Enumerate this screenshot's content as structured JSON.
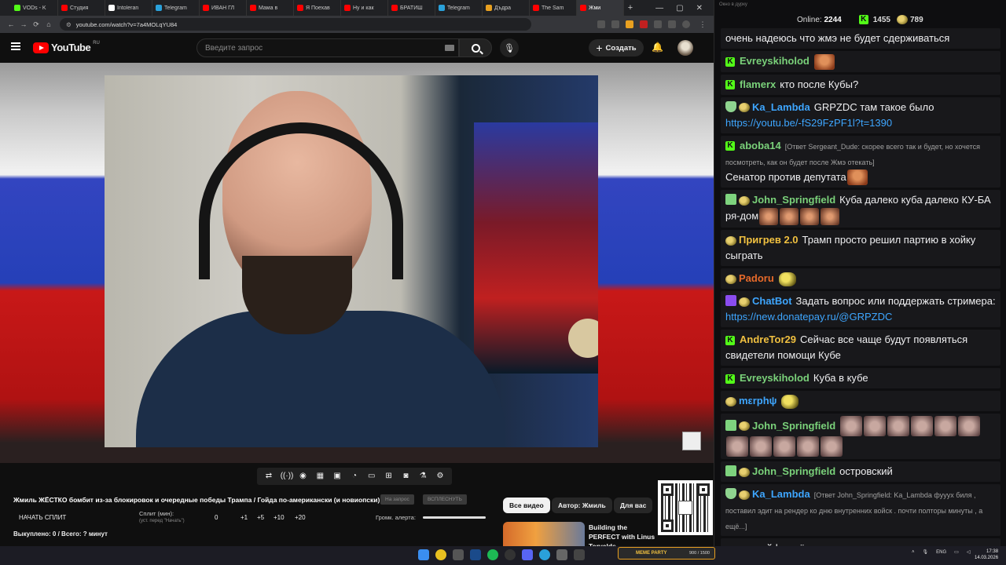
{
  "browser": {
    "tabs": [
      {
        "label": "VODs - K",
        "color": "#53fc18"
      },
      {
        "label": "Студия",
        "color": "#ff0000"
      },
      {
        "label": "Intoleran",
        "color": "#ffffff"
      },
      {
        "label": "Telegram",
        "color": "#2aa1da"
      },
      {
        "label": "ИВАН ГЛ",
        "color": "#ff0000"
      },
      {
        "label": "Мама в",
        "color": "#ff0000"
      },
      {
        "label": "Я Поехав",
        "color": "#ff0000"
      },
      {
        "label": "Ну и как",
        "color": "#ff0000"
      },
      {
        "label": "БРАТИШ",
        "color": "#ff0000"
      },
      {
        "label": "Telegram",
        "color": "#2aa1da"
      },
      {
        "label": "Дъдра",
        "color": "#e8a020"
      },
      {
        "label": "The Sam",
        "color": "#ff0000"
      },
      {
        "label": "Жми",
        "color": "#ff0000",
        "active": true
      }
    ],
    "new_tab": "+",
    "url": "youtube.com/watch?v=7a4MOLqYU84"
  },
  "youtube": {
    "logo_text": "YouTube",
    "logo_region": "RU",
    "search_placeholder": "Введите запрос",
    "create_label": "Создать",
    "video_title": "Жмиль ЖЁСТКО бомбит из-за блокировок и очередные победы Трампа / Гойда по-американски (и новиопски)",
    "title_btn_1": "На запрос",
    "title_btn_2": "ВСПЛЕСНУТЬ",
    "filters": [
      "Все видео",
      "Автор: Жмиль",
      "Для вас"
    ],
    "recommended_title": "Building the PERFECT with Linus Torvalds"
  },
  "split_panel": {
    "start_label": "НАЧАТЬ СПЛИТ",
    "split_label": "Сплит (мин):",
    "split_hint": "(уст. перед \"Начать\")",
    "values": [
      "0",
      "+1",
      "+5",
      "+10",
      "+20"
    ],
    "alert_label": "Громк. алерта:",
    "alert_level": 1.0,
    "paid_status": "Выкуплено: 0 / Всего: ? минут"
  },
  "chat": {
    "window_title": "Окно в дурку",
    "online_label": "Online:",
    "online_count": "2244",
    "kick_count": "1455",
    "pepe_count": "789",
    "messages": [
      {
        "user": "",
        "color": "#efeff1",
        "badges": [],
        "text": "очень надеюсь что жмэ не будет сдерживаться",
        "emotes": []
      },
      {
        "user": "Evreyskiholod",
        "color": "#7ad17a",
        "badges": [
          "kick"
        ],
        "text": "",
        "emotes": [
          "face"
        ]
      },
      {
        "user": "flamerx",
        "color": "#7ad17a",
        "badges": [
          "kick"
        ],
        "text": "кто после Кубы?",
        "emotes": []
      },
      {
        "user": "Ka_Lambda",
        "color": "#3ea6ff",
        "badges": [
          "shield",
          "pepe"
        ],
        "text": "GRPZDC там такое было",
        "link": "https://youtu.be/-fS29FzPF1l?t=1390",
        "emotes": []
      },
      {
        "user": "aboba14",
        "color": "#7ad17a",
        "badges": [
          "kick"
        ],
        "reply": "[Ответ Sergeant_Dude: скорее всего так и будет, но хочется посмотреть, как он будет после Жмэ отекать]",
        "text": "Сенатор против депутата",
        "emotes": [
          "face"
        ]
      },
      {
        "user": "John_Springfield",
        "color": "#7ad17a",
        "badges": [
          "pencil",
          "pepe"
        ],
        "text": "Куба далеко куба далеко КУ-БА ря-дом",
        "emotes": [
          "grp",
          "grp",
          "grp",
          "grp"
        ]
      },
      {
        "user": "Пригрев 2.0",
        "color": "#f0c040",
        "badges": [
          "pepe"
        ],
        "text": "Трамп просто решил партию в хойку сыграть",
        "emotes": []
      },
      {
        "user": "Padoru",
        "color": "#e86a2a",
        "badges": [
          "pepe"
        ],
        "text": "",
        "emotes": [
          "pp"
        ]
      },
      {
        "user": "ChatBot",
        "color": "#3ea6ff",
        "badges": [
          "bot",
          "pepe"
        ],
        "text": "Задать вопрос или поддержать стримера:",
        "link": "https://new.donatepay.ru/@GRPZDC",
        "emotes": []
      },
      {
        "user": "AndreTor29",
        "color": "#f0c040",
        "badges": [
          "kick"
        ],
        "text": "Сейчас все чаще будут появляться свидетели помощи Кубе",
        "emotes": []
      },
      {
        "user": "Evreyskiholod",
        "color": "#7ad17a",
        "badges": [
          "kick"
        ],
        "text": "Куба в кубе",
        "emotes": []
      },
      {
        "user": "mεrphψ",
        "color": "#3ea6ff",
        "badges": [
          "pepe"
        ],
        "text": "",
        "emotes": [
          "pp"
        ]
      },
      {
        "user": "John_Springfield",
        "color": "#7ad17a",
        "badges": [
          "pencil",
          "pepe"
        ],
        "text": "",
        "emotes": [
          "cat",
          "cat",
          "cat",
          "cat",
          "cat",
          "cat",
          "cat",
          "cat",
          "cat",
          "cat",
          "cat"
        ]
      },
      {
        "user": "John_Springfield",
        "color": "#7ad17a",
        "badges": [
          "pencil",
          "pepe"
        ],
        "text": "островский",
        "emotes": []
      },
      {
        "user": "Ka_Lambda",
        "color": "#3ea6ff",
        "badges": [
          "shield",
          "pepe"
        ],
        "reply": "[Ответ John_Springfield: Ka_Lambda фууух биля , поставил эдит на рендер ко дню внутренних войск . почти полторы минуты , а ещё...]",
        "text": "",
        "emotes": []
      },
      {
        "user": "",
        "color": "#efeff1",
        "badges": [],
        "text": "ляяяя кайф, ждём",
        "emotes": []
      }
    ]
  },
  "taskbar": {
    "widget_label": "MEME PARTY",
    "widget_progress": "900 / 1500",
    "lang": "ENG",
    "time": "17:38",
    "date": "14.03.2026"
  }
}
